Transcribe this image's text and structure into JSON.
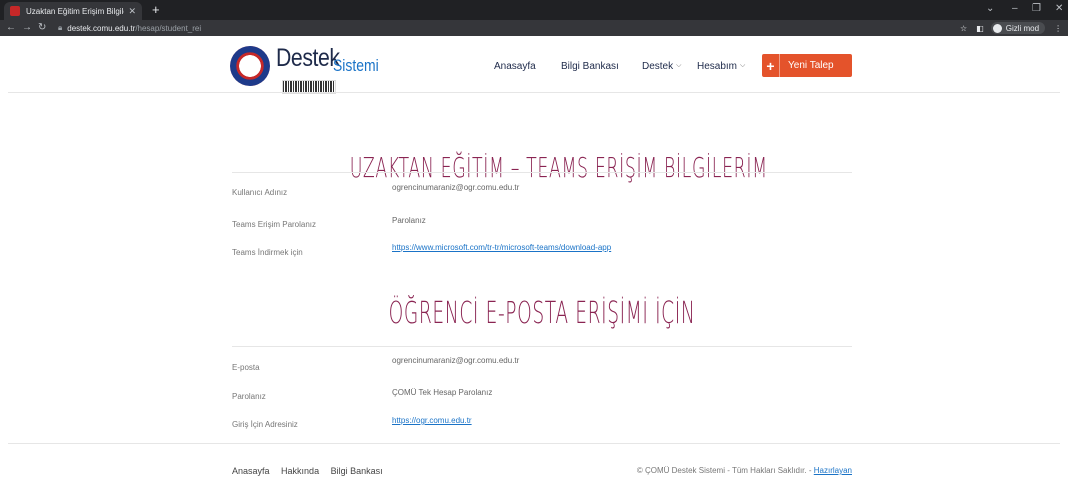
{
  "browser": {
    "tab_title": "Uzaktan Eğitim Erişim Bilgilerim",
    "url_host": "destek.comu.edu.tr",
    "url_path": "/hesap/student_rei",
    "incognito_label": "Gizli mod"
  },
  "header": {
    "logo_text": "Destek",
    "logo_subtext": "Sistemi",
    "nav": {
      "home": "Anasayfa",
      "knowledge_base": "Bilgi Bankası",
      "support": "Destek",
      "account": "Hesabım"
    },
    "new_ticket_label": "Yeni Talep"
  },
  "teams_section": {
    "title": "UZAKTAN EĞİTİM – TEAMS ERİŞİM BİLGİLERİM",
    "rows": [
      {
        "label": "Kullanıcı Adınız",
        "value": "ogrencinumaraniz@ogr.comu.edu.tr"
      },
      {
        "label": "Teams Erişim Parolanız",
        "value": "Parolanız"
      },
      {
        "label": "Teams İndirmek için",
        "value": "https://www.microsoft.com/tr-tr/microsoft-teams/download-app"
      }
    ]
  },
  "email_section": {
    "title": "ÖĞRENCİ E-POSTA ERİŞİMİ İÇİN",
    "rows": [
      {
        "label": "E-posta",
        "value": "ogrencinumaraniz@ogr.comu.edu.tr"
      },
      {
        "label": "Parolanız",
        "value": "ÇOMÜ Tek Hesap Parolanız"
      },
      {
        "label": "Giriş İçin Adresiniz",
        "value": "https://ogr.comu.edu.tr"
      }
    ]
  },
  "footer": {
    "links": [
      "Anasayfa",
      "Hakkında",
      "Bilgi Bankası"
    ],
    "copyright": "© ÇOMÜ Destek Sistemi - Tüm Hakları Saklıdır. -",
    "prepared_by": "Hazırlayan"
  },
  "colors": {
    "accent": "#e4532b",
    "title": "#8a2452",
    "link": "#1a73c7"
  }
}
